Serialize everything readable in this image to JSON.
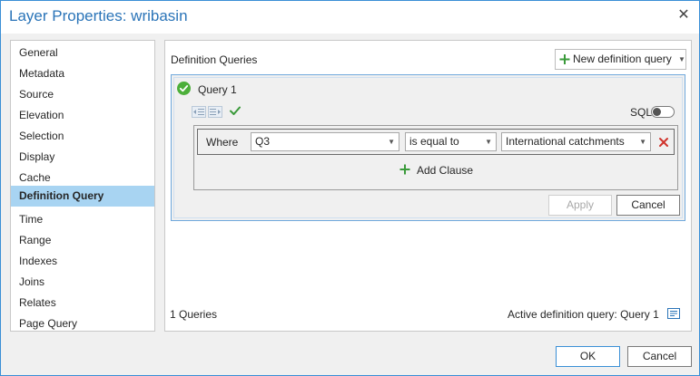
{
  "window": {
    "title": "Layer Properties: wribasin"
  },
  "sidebar": {
    "items": [
      {
        "label": "General"
      },
      {
        "label": "Metadata"
      },
      {
        "label": "Source"
      },
      {
        "label": "Elevation"
      },
      {
        "label": "Selection"
      },
      {
        "label": "Display"
      },
      {
        "label": "Cache"
      },
      {
        "label": "Definition Query",
        "selected": true
      },
      {
        "label": "Time"
      },
      {
        "label": "Range"
      },
      {
        "label": "Indexes"
      },
      {
        "label": "Joins"
      },
      {
        "label": "Relates"
      },
      {
        "label": "Page Query"
      }
    ]
  },
  "definition": {
    "section_label": "Definition Queries",
    "new_query_button": "New definition query",
    "query": {
      "name": "Query 1",
      "sql_label": "SQL",
      "sql_enabled": false,
      "clause": {
        "where_label": "Where",
        "field": "Q3",
        "operator": "is equal to",
        "value": "International catchments"
      },
      "add_clause_label": "Add Clause",
      "apply_label": "Apply",
      "cancel_label": "Cancel"
    },
    "query_count": "1 Queries",
    "active_query": "Active definition query: Query 1"
  },
  "dialog": {
    "ok_label": "OK",
    "cancel_label": "Cancel"
  },
  "icons": {
    "close": "close-icon",
    "plus": "plus-icon",
    "valid": "check-circle-icon",
    "indent": "indent-icon",
    "outdent": "outdent-icon",
    "verify": "checkmark-icon",
    "remove": "remove-clause-icon",
    "active": "active-query-icon"
  },
  "colors": {
    "title": "#2a74b8",
    "selected_nav": "#a8d4f2",
    "valid_green": "#4caf3a",
    "plus_green": "#3a9a3a",
    "remove_red": "#d0342c",
    "card_border": "#6fa8dc"
  }
}
